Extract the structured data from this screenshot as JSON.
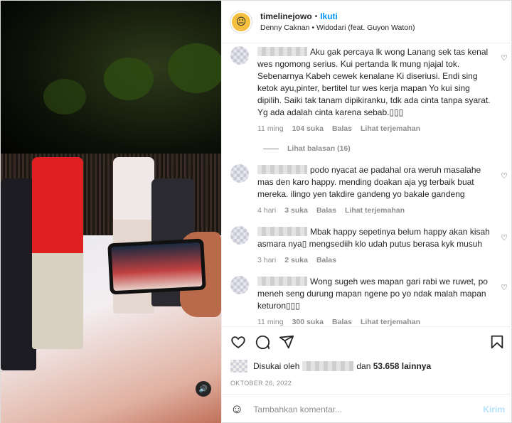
{
  "header": {
    "username": "timelinejowo",
    "separator": "•",
    "follow_label": "Ikuti",
    "audio": "Denny Caknan • Widodari (feat. Guyon Waton)"
  },
  "comments": [
    {
      "text": "Aku gak percaya lk wong Lanang sek tas kenal wes ngomong serius. Kui pertanda lk mung njajal tok. Sebenarnya Kabeh cewek kenalane Ki diseriusi. Endi sing ketok ayu,pinter, bertitel tur wes kerja mapan Yo kui sing dipilih. Saiki tak tanam dipikiranku, tdk ada cinta tanpa syarat. Yg ada adalah cinta karena sebab.▯▯▯",
      "time": "11 ming",
      "likes": "104 suka",
      "reply": "Balas",
      "translate": "Lihat terjemahan",
      "view_replies": "Lihat balasan (16)"
    },
    {
      "text": "podo nyacat ae padahal ora weruh masalahe mas den karo happy. mending doakan aja yg terbaik buat mereka. ilingo yen takdire gandeng yo bakale gandeng",
      "time": "4 hari",
      "likes": "3 suka",
      "reply": "Balas",
      "translate": "Lihat terjemahan"
    },
    {
      "text": "Mbak happy sepetinya belum happy akan kisah asmara nya▯ mengsediih klo udah putus berasa kyk musuh",
      "time": "3 hari",
      "likes": "2 suka",
      "reply": "Balas"
    },
    {
      "text": "Wong sugeh wes mapan gari rabi we ruwet, po meneh seng durung mapan ngene po yo ndak malah mapan keturon▯▯▯",
      "time": "11 ming",
      "likes": "300 suka",
      "reply": "Balas",
      "translate": "Lihat terjemahan"
    }
  ],
  "likes": {
    "prefix": "Disukai oleh",
    "suffix_and": "dan",
    "count": "53.658 lainnya"
  },
  "date": "OKTOBER 26, 2022",
  "add_comment": {
    "placeholder": "Tambahkan komentar...",
    "post_label": "Kirim"
  },
  "colors": {
    "accent": "#0095f6",
    "muted": "#8e8e8e",
    "text": "#262626"
  }
}
